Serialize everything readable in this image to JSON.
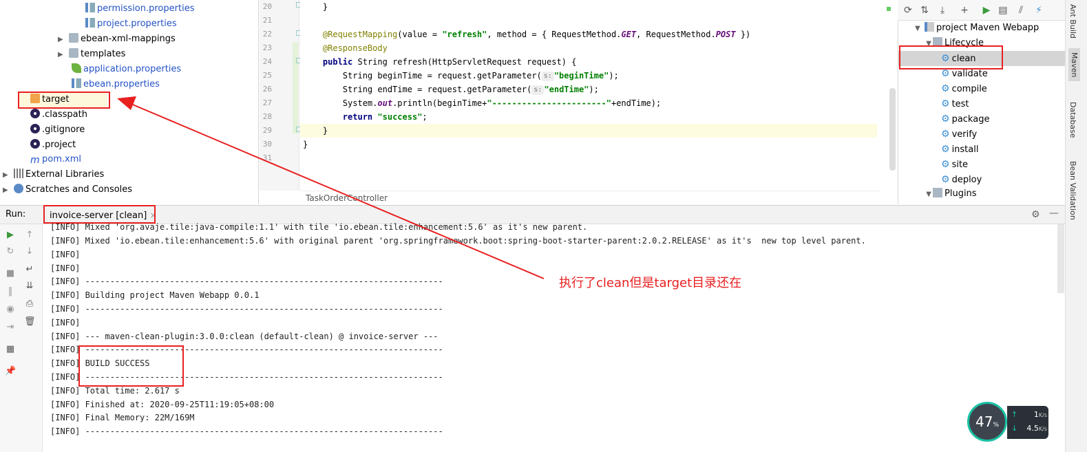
{
  "tree": {
    "items": [
      {
        "label": "permission.properties",
        "icon": "properties-file-icon",
        "blue": true
      },
      {
        "label": "project.properties",
        "icon": "properties-file-icon",
        "blue": true
      },
      {
        "label": "ebean-xml-mappings",
        "icon": "folder-icon",
        "blue": false
      },
      {
        "label": "templates",
        "icon": "folder-icon",
        "blue": false
      },
      {
        "label": "application.properties",
        "icon": "spring-leaf-icon",
        "blue": true
      },
      {
        "label": "ebean.properties",
        "icon": "properties-file-icon",
        "blue": true
      },
      {
        "label": "target",
        "icon": "orange-folder-icon",
        "blue": false
      },
      {
        "label": ".classpath",
        "icon": "eclipse-icon",
        "blue": false
      },
      {
        "label": ".gitignore",
        "icon": "eclipse-icon",
        "blue": false
      },
      {
        "label": ".project",
        "icon": "eclipse-icon",
        "blue": false
      },
      {
        "label": "pom.xml",
        "icon": "maven-m-icon",
        "blue": true
      },
      {
        "label": "External Libraries",
        "icon": "libraries-icon",
        "blue": false
      },
      {
        "label": "Scratches and Consoles",
        "icon": "scratches-icon",
        "blue": false
      }
    ]
  },
  "editor": {
    "line_numbers": [
      "20",
      "21",
      "22",
      "23",
      "24",
      "25",
      "26",
      "27",
      "28",
      "29",
      "30",
      "31"
    ],
    "breadcrumb": "TaskOrderController",
    "code": {
      "l20": "    }",
      "l22_ann": "@RequestMapping",
      "l22_a": "(value = ",
      "l22_s1": "\"refresh\"",
      "l22_b": ", method = { RequestMethod.",
      "l22_c1": "GET",
      "l22_c": ", RequestMethod.",
      "l22_c2": "POST",
      "l22_d": " })",
      "l23_ann": "@ResponseBody",
      "l24_kw": "public",
      "l24_rest": " String refresh(HttpServletRequest request) {",
      "l25_a": "        String beginTime = request.getParameter(",
      "hint_s": "s:",
      "l25_s": "\"beginTime\"",
      "l25_b": ");",
      "l26_a": "        String endTime = request.getParameter(",
      "l26_s": "\"endTime\"",
      "l26_b": ");",
      "l27_a": "        System.",
      "l27_out": "out",
      "l27_b": ".println(beginTime+",
      "l27_s": "\"-----------------------\"",
      "l27_c": "+endTime);",
      "l28_kw": "return",
      "l28_s": "\"success\"",
      "l28_b": ";",
      "l29": "    }",
      "l30": "}"
    }
  },
  "maven": {
    "toolbar": [
      "refresh-icon",
      "reimport-icon",
      "download-icon",
      "add-icon",
      "run-icon",
      "run-config-icon",
      "toggle-offline-icon",
      "skip-tests-icon"
    ],
    "project": "project Maven Webapp",
    "lifecycle": "Lifecycle",
    "goals": [
      "clean",
      "validate",
      "compile",
      "test",
      "package",
      "verify",
      "install",
      "site",
      "deploy"
    ],
    "plugins": "Plugins"
  },
  "right_tabs": [
    "Ant Build",
    "Maven",
    "Database",
    "Bean Validation"
  ],
  "run": {
    "label": "Run:",
    "tab": "invoice-server [clean]",
    "close": "×",
    "console": [
      "[INFO] Mixed 'org.avaje.tile:java-compile:1.1' with tile 'io.ebean.tile:enhancement:5.6' as it's new parent.",
      "[INFO] Mixed 'io.ebean.tile:enhancement:5.6' with original parent 'org.springframework.boot:spring-boot-starter-parent:2.0.2.RELEASE' as it's  new top level parent.",
      "[INFO]",
      "[INFO]",
      "[INFO] ------------------------------------------------------------------------",
      "[INFO] Building project Maven Webapp 0.0.1",
      "[INFO] ------------------------------------------------------------------------",
      "[INFO]",
      "[INFO] --- maven-clean-plugin:3.0.0:clean (default-clean) @ invoice-server ---",
      "[INFO] ------------------------------------------------------------------------",
      "[INFO] BUILD SUCCESS",
      "[INFO] ------------------------------------------------------------------------",
      "[INFO] Total time: 2.617 s",
      "[INFO] Finished at: 2020-09-25T11:19:05+08:00",
      "[INFO] Final Memory: 22M/169M",
      "[INFO] ------------------------------------------------------------------------"
    ]
  },
  "annotation": "执行了clean但是target目录还在",
  "widget": {
    "percent": "47",
    "percent_unit": "%",
    "up_value": "1",
    "up_unit": "K/s",
    "down_value": "4.5",
    "down_unit": "K/s"
  },
  "colors": {
    "annotation_red": "#e82020",
    "widget_ring": "#19c2a5"
  }
}
